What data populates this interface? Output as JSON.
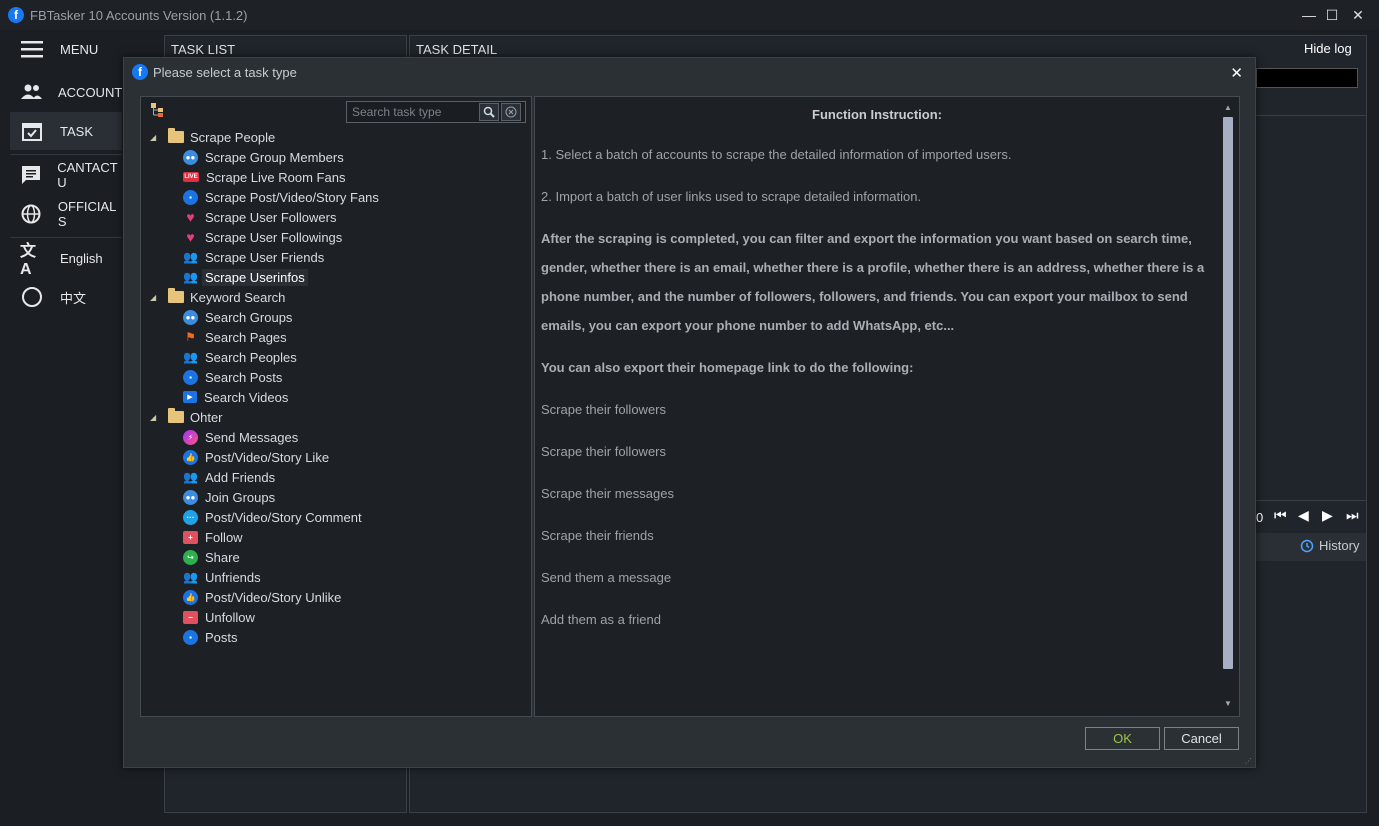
{
  "app": {
    "title": "FBTasker 10 Accounts Version (1.1.2)",
    "logo_letter": "f",
    "minimize_icon": "—",
    "maximize_icon": "☐",
    "close_icon": "✕"
  },
  "sidebar": {
    "items": [
      {
        "label": "MENU",
        "icon": "hamburger-icon"
      },
      {
        "label": "ACCOUNT",
        "icon": "people-icon"
      },
      {
        "label": "TASK",
        "icon": "calendar-check-icon"
      },
      {
        "label": "CANTACT U",
        "icon": "message-icon"
      },
      {
        "label": "OFFICIAL S",
        "icon": "globe-icon"
      },
      {
        "label": "English",
        "icon": "translate-icon"
      },
      {
        "label": "中文",
        "icon": "circle-icon"
      }
    ]
  },
  "background": {
    "task_list_header": "TASK LIST",
    "task_detail_header": "TASK DETAIL",
    "hide_log": "Hide log",
    "pager_zero": "0",
    "history": "History"
  },
  "dialog": {
    "title": "Please select a task type",
    "close_icon": "✕",
    "search_placeholder": "Search task type",
    "groups": [
      {
        "label": "Scrape People",
        "items": [
          {
            "label": "Scrape Group Members",
            "icon": "group-icon"
          },
          {
            "label": "Scrape Live Room Fans",
            "icon": "live-icon"
          },
          {
            "label": "Scrape Post/Video/Story Fans",
            "icon": "post-icon"
          },
          {
            "label": "Scrape User Followers",
            "icon": "heart-icon"
          },
          {
            "label": "Scrape User Followings",
            "icon": "heart-icon"
          },
          {
            "label": "Scrape User Friends",
            "icon": "friends-icon"
          },
          {
            "label": "Scrape Userinfos",
            "icon": "friends-icon"
          }
        ]
      },
      {
        "label": "Keyword Search",
        "items": [
          {
            "label": "Search Groups",
            "icon": "group-icon"
          },
          {
            "label": "Search Pages",
            "icon": "flag-icon"
          },
          {
            "label": "Search Peoples",
            "icon": "friends-icon"
          },
          {
            "label": "Search Posts",
            "icon": "post-icon"
          },
          {
            "label": "Search Videos",
            "icon": "video-icon"
          }
        ]
      },
      {
        "label": "Ohter",
        "items": [
          {
            "label": "Send Messages",
            "icon": "messenger-icon"
          },
          {
            "label": "Post/Video/Story Like",
            "icon": "like-icon"
          },
          {
            "label": "Add Friends",
            "icon": "friends-icon"
          },
          {
            "label": "Join Groups",
            "icon": "group-icon"
          },
          {
            "label": "Post/Video/Story Comment",
            "icon": "comment-icon"
          },
          {
            "label": "Follow",
            "icon": "follow-icon"
          },
          {
            "label": "Share",
            "icon": "share-icon"
          },
          {
            "label": "Unfriends",
            "icon": "friends-icon"
          },
          {
            "label": "Post/Video/Story Unlike",
            "icon": "like-icon"
          },
          {
            "label": "Unfollow",
            "icon": "follow-icon"
          },
          {
            "label": "Posts",
            "icon": "post-icon"
          }
        ]
      }
    ],
    "selected_item": "Scrape Userinfos",
    "info": {
      "title": "Function Instruction:",
      "p1": "1. Select a batch of accounts to scrape the detailed information of imported users.",
      "p2": "2. Import a batch of user links used to scrape detailed information.",
      "p3": "After the scraping is completed, you can filter and export the information you want based on search time, gender, whether there is an email, whether there is a profile, whether there is an address, whether there is a phone number, and the number of followers, followers, and friends. You can export your mailbox to send emails, you can export your phone number to add WhatsApp, etc...",
      "p4": "You can also export their homepage link to do the following:",
      "p5": "Scrape their followers",
      "p6": "Scrape their followers",
      "p7": "Scrape their messages",
      "p8": "Scrape their friends",
      "p9": "Send them a message",
      "p10": "Add them as a friend"
    },
    "ok_label": "OK",
    "cancel_label": "Cancel"
  },
  "colors": {
    "ok_text": "#9ac54a",
    "facebook_blue": "#1877f2"
  }
}
